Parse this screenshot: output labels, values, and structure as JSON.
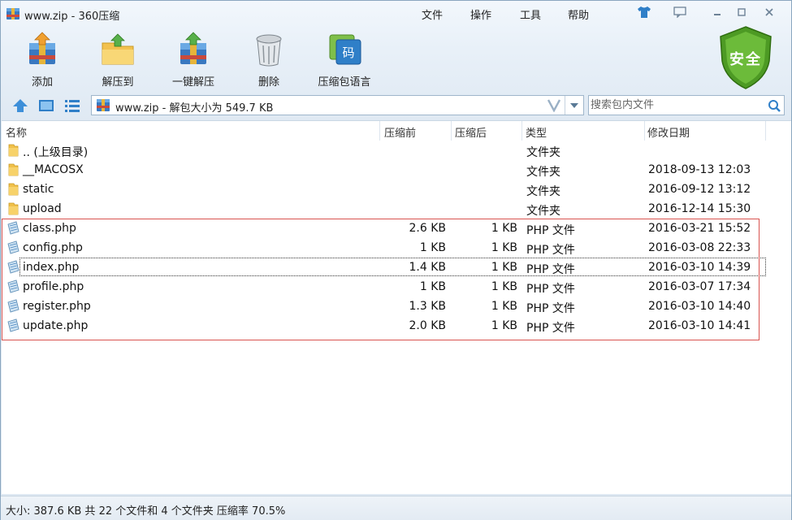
{
  "window": {
    "title": "www.zip - 360压缩"
  },
  "menu": {
    "file": "文件",
    "operate": "操作",
    "tools": "工具",
    "help": "帮助"
  },
  "toolbar": {
    "add": "添加",
    "extract_to": "解压到",
    "one_click_extract": "一键解压",
    "delete": "删除",
    "archive_language": "压缩包语言"
  },
  "security_badge": "安全",
  "address": {
    "path": "www.zip - 解包大小为 549.7 KB"
  },
  "search": {
    "placeholder": "搜索包内文件"
  },
  "columns": {
    "name": "名称",
    "packed": "压缩前",
    "unpacked": "压缩后",
    "type": "类型",
    "modified": "修改日期"
  },
  "rows": [
    {
      "icon": "folder-icon",
      "name": ".. (上级目录)",
      "packed": "",
      "unpacked": "",
      "type": "文件夹",
      "date": ""
    },
    {
      "icon": "folder-icon",
      "name": "__MACOSX",
      "packed": "",
      "unpacked": "",
      "type": "文件夹",
      "date": "2018-09-13 12:03"
    },
    {
      "icon": "folder-icon",
      "name": "static",
      "packed": "",
      "unpacked": "",
      "type": "文件夹",
      "date": "2016-09-12 13:12"
    },
    {
      "icon": "folder-icon",
      "name": "upload",
      "packed": "",
      "unpacked": "",
      "type": "文件夹",
      "date": "2016-12-14 15:30"
    },
    {
      "icon": "php-file-icon",
      "name": "class.php",
      "packed": "2.6 KB",
      "unpacked": "1 KB",
      "type": "PHP 文件",
      "date": "2016-03-21 15:52"
    },
    {
      "icon": "php-file-icon",
      "name": "config.php",
      "packed": "1 KB",
      "unpacked": "1 KB",
      "type": "PHP 文件",
      "date": "2016-03-08 22:33"
    },
    {
      "icon": "php-file-icon",
      "name": "index.php",
      "packed": "1.4 KB",
      "unpacked": "1 KB",
      "type": "PHP 文件",
      "date": "2016-03-10 14:39"
    },
    {
      "icon": "php-file-icon",
      "name": "profile.php",
      "packed": "1 KB",
      "unpacked": "1 KB",
      "type": "PHP 文件",
      "date": "2016-03-07 17:34"
    },
    {
      "icon": "php-file-icon",
      "name": "register.php",
      "packed": "1.3 KB",
      "unpacked": "1 KB",
      "type": "PHP 文件",
      "date": "2016-03-10 14:40"
    },
    {
      "icon": "php-file-icon",
      "name": "update.php",
      "packed": "2.0 KB",
      "unpacked": "1 KB",
      "type": "PHP 文件",
      "date": "2016-03-10 14:41"
    }
  ],
  "status": {
    "text": "大小: 387.6 KB 共 22 个文件和 4 个文件夹 压缩率 70.5%"
  },
  "colors": {
    "accent": "#2f7fc8",
    "highlight_border": "#d9534f",
    "shield": "#5aa02c"
  }
}
